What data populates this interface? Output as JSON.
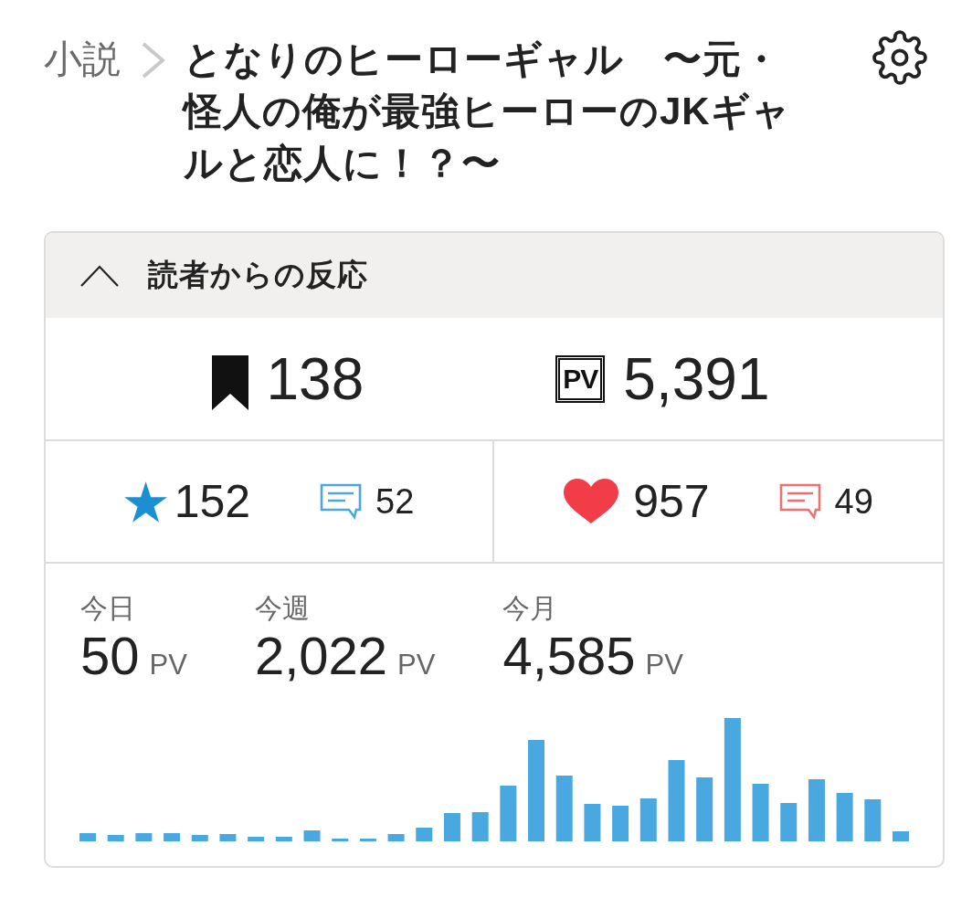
{
  "breadcrumb": {
    "category": "小説",
    "title": "となりのヒーローギャル　〜元・怪人の俺が最強ヒーローのJKギャルと恋人に！？〜"
  },
  "reactions_panel": {
    "title": "読者からの反応",
    "expanded": true,
    "totals": [
      {
        "kind": "bookmark",
        "count": "138"
      },
      {
        "kind": "pv",
        "badge": "PV",
        "count": "5,391"
      }
    ],
    "ratings": [
      {
        "kind": "star",
        "count": "152",
        "comments": "52"
      },
      {
        "kind": "heart",
        "count": "957",
        "comments": "49"
      }
    ],
    "page_views": [
      {
        "label": "今日",
        "count": "50",
        "unit": "PV"
      },
      {
        "label": "今週",
        "count": "2,022",
        "unit": "PV"
      },
      {
        "label": "今月",
        "count": "4,585",
        "unit": "PV"
      }
    ]
  }
}
